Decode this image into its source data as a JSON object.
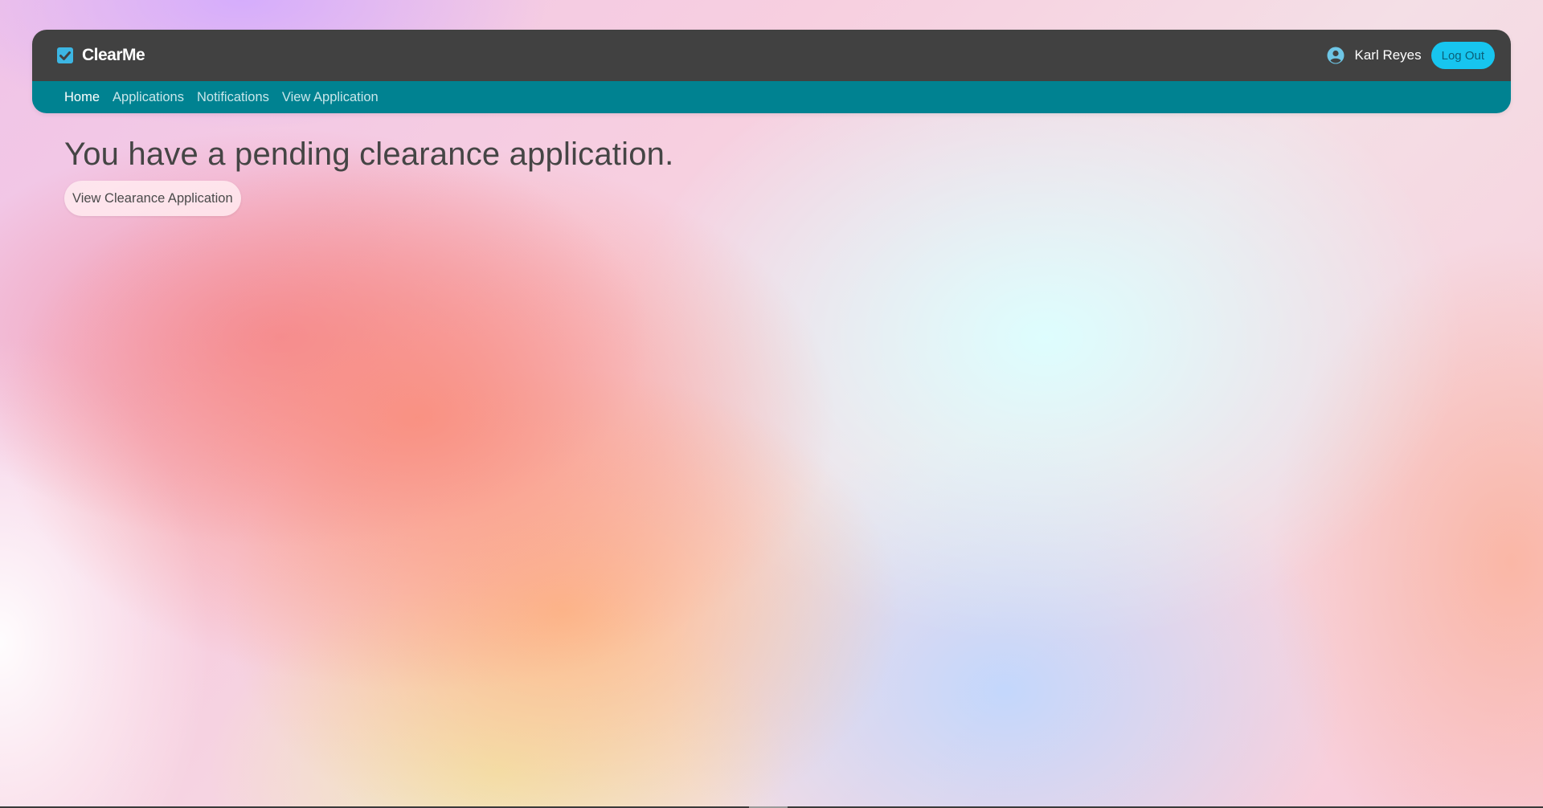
{
  "app": {
    "brand_name": "ClearMe",
    "brand_icon": "checkbox-checked-icon"
  },
  "header": {
    "user_icon": "user-circle-icon",
    "user_name": "Karl Reyes",
    "logout_label": "Log Out"
  },
  "nav": {
    "items": [
      {
        "label": "Home",
        "active": true
      },
      {
        "label": "Applications",
        "active": false
      },
      {
        "label": "Notifications",
        "active": false
      },
      {
        "label": "View Application",
        "active": false
      }
    ]
  },
  "main": {
    "headline": "You have a pending clearance application.",
    "view_button_label": "View Clearance Application"
  },
  "colors": {
    "topbar": "#414141",
    "subnav": "#008291",
    "accent": "#17c5ef",
    "brand_icon": "#3cb6e3"
  }
}
